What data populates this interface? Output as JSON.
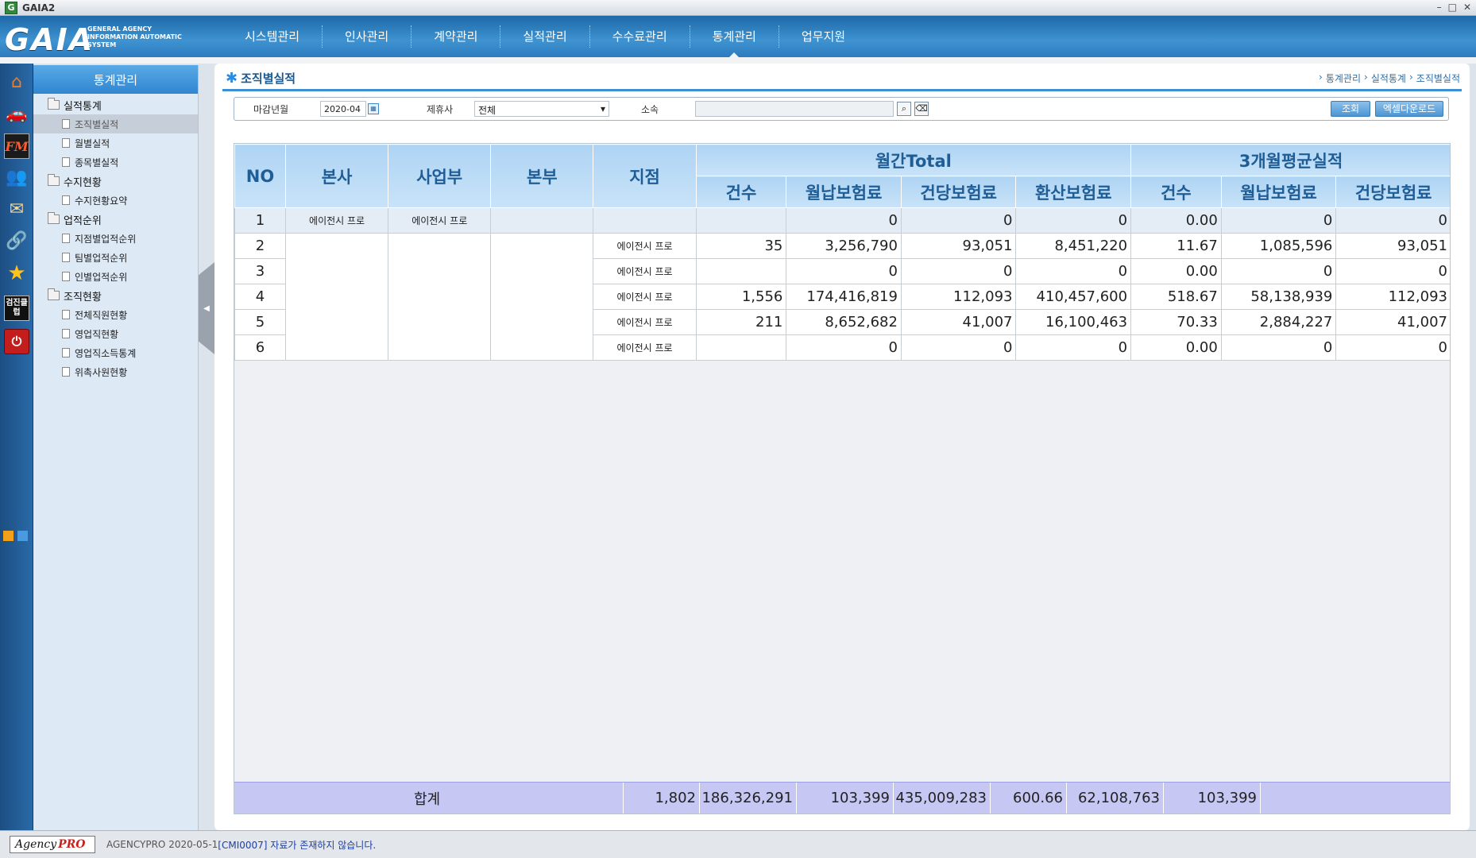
{
  "window": {
    "title": "GAIA2",
    "icon": "G",
    "controls": [
      "–",
      "□",
      "✕"
    ]
  },
  "brand": {
    "logo": "GAIA",
    "subtitle": "GENERAL AGENCY INFORMATION AUTOMATIC SYSTEM"
  },
  "topnav": {
    "items": [
      "시스템관리",
      "인사관리",
      "계약관리",
      "실적관리",
      "수수료관리",
      "통계관리",
      "업무지원"
    ],
    "active": "통계관리"
  },
  "sidebar_icons": [
    "home-icon",
    "car-icon",
    "fm-icon",
    "users-icon",
    "mail-icon",
    "link-icon",
    "star-icon",
    "checkup-club-icon",
    "logout-icon"
  ],
  "sidebar_icon_text": {
    "fm": "FM",
    "checkup": "검진클럽",
    "logout": "⏻"
  },
  "tree": {
    "header": "통계관리",
    "groups": [
      {
        "label": "실적통계",
        "items": [
          "조직별실적",
          "월별실적",
          "종목별실적"
        ]
      },
      {
        "label": "수지현황",
        "items": [
          "수지현황요약"
        ]
      },
      {
        "label": "업적순위",
        "items": [
          "지점별업적순위",
          "팀별업적순위",
          "인별업적순위"
        ]
      },
      {
        "label": "조직현황",
        "items": [
          "전체직원현황",
          "영업직현황",
          "영업직소득통계",
          "위촉사원현황"
        ]
      }
    ],
    "selected": "조직별실적"
  },
  "page": {
    "title": "조직별실적",
    "breadcrumb": [
      "통계관리",
      "실적통계",
      "조직별실적"
    ]
  },
  "filters": {
    "date_label": "마감년월",
    "date_value": "2020-04",
    "partner_label": "제휴사",
    "partner_value": "전체",
    "org_label": "소속",
    "org_value": "",
    "query_button": "조회",
    "excel_button": "엑셀다운로드"
  },
  "table": {
    "headers": {
      "no": "NO",
      "hq": "본사",
      "division": "사업부",
      "region": "본부",
      "branch": "지점",
      "monthly_group": "월간Total",
      "avg_group": "3개월평균실적",
      "cnt": "건수",
      "monthly_premium": "월납보험료",
      "per_case": "건당보험료",
      "converted": "환산보험료"
    },
    "rows": [
      {
        "no": "1",
        "hq": "에이전시 프로",
        "division": "에이전시 프로",
        "region": "",
        "branch": "",
        "cnt": "",
        "monthly": "0",
        "per_case": "0",
        "converted": "0",
        "avg_cnt": "0.00",
        "avg_monthly": "0",
        "avg_per_case": "0"
      },
      {
        "no": "2",
        "hq": "",
        "division": "",
        "region": "",
        "branch": "에이전시 프로",
        "cnt": "35",
        "monthly": "3,256,790",
        "per_case": "93,051",
        "converted": "8,451,220",
        "avg_cnt": "11.67",
        "avg_monthly": "1,085,596",
        "avg_per_case": "93,051"
      },
      {
        "no": "3",
        "hq": "",
        "division": "",
        "region": "",
        "branch": "에이전시 프로",
        "cnt": "",
        "monthly": "0",
        "per_case": "0",
        "converted": "0",
        "avg_cnt": "0.00",
        "avg_monthly": "0",
        "avg_per_case": "0"
      },
      {
        "no": "4",
        "hq": "",
        "division": "",
        "region": "",
        "branch": "에이전시 프로",
        "cnt": "1,556",
        "monthly": "174,416,819",
        "per_case": "112,093",
        "converted": "410,457,600",
        "avg_cnt": "518.67",
        "avg_monthly": "58,138,939",
        "avg_per_case": "112,093"
      },
      {
        "no": "5",
        "hq": "",
        "division": "",
        "region": "",
        "branch": "에이전시 프로",
        "cnt": "211",
        "monthly": "8,652,682",
        "per_case": "41,007",
        "converted": "16,100,463",
        "avg_cnt": "70.33",
        "avg_monthly": "2,884,227",
        "avg_per_case": "41,007"
      },
      {
        "no": "6",
        "hq": "",
        "division": "",
        "region": "",
        "branch": "에이전시 프로",
        "cnt": "",
        "monthly": "0",
        "per_case": "0",
        "converted": "0",
        "avg_cnt": "0.00",
        "avg_monthly": "0",
        "avg_per_case": "0"
      }
    ],
    "total": {
      "label": "합계",
      "cnt": "1,802",
      "monthly": "186,326,291",
      "per_case": "103,399",
      "converted": "435,009,283",
      "avg_cnt": "600.66",
      "avg_monthly": "62,108,763",
      "avg_per_case": "103,399"
    }
  },
  "status": {
    "brand": "Agency",
    "brand_accent": "PRO",
    "text": "AGENCYPRO 2020-05-1",
    "message": "[CMI0007] 자료가 존재하지 않습니다."
  },
  "colors": {
    "header_blue": "#2f86d0",
    "total_row": "#c6c7f3",
    "nav_bg": "#3f93d0"
  }
}
